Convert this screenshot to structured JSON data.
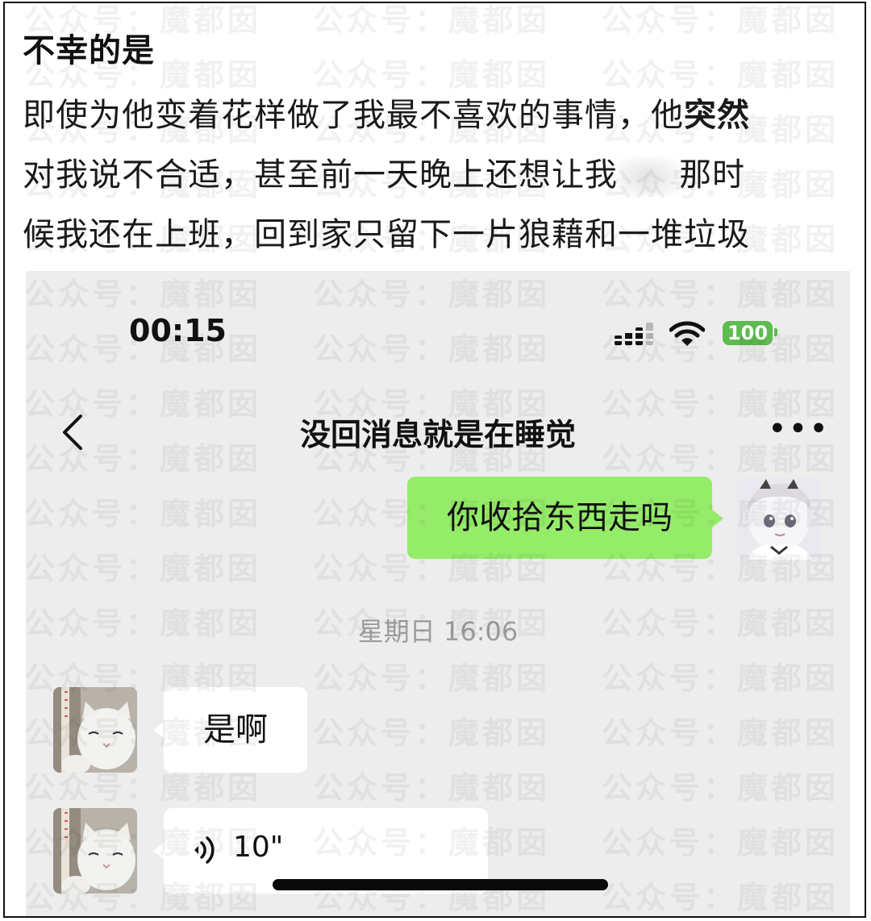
{
  "post": {
    "title": "不幸的是",
    "line1_a": "即使为他变着花样做了我最不喜欢的事情，他",
    "line1_b": "突然",
    "line2_a": "对我说不合适，甚至前一天晚上还想让我",
    "line2_b": "那时",
    "line3": "候我还在上班，回到家只留下一片狼藉和一堆垃圾"
  },
  "phone": {
    "status": {
      "time": "00:15",
      "battery": "100",
      "icons": [
        "signal-icon",
        "wifi-icon",
        "battery-icon"
      ]
    },
    "nav": {
      "title": "没回消息就是在睡觉",
      "more": "•••",
      "back_icon": "chevron-left-icon"
    },
    "messages": [
      {
        "side": "outgoing",
        "text": "你收拾东西走吗",
        "color": "#95ec69"
      },
      {
        "type": "timestamp",
        "text": "星期日 16:06"
      },
      {
        "side": "incoming",
        "text": "是啊",
        "color": "#ffffff"
      },
      {
        "side": "incoming",
        "type": "voice",
        "duration": "10\"",
        "icon": "voice-wave-icon"
      }
    ]
  },
  "watermark": {
    "text": "公众号：魔都囡"
  }
}
